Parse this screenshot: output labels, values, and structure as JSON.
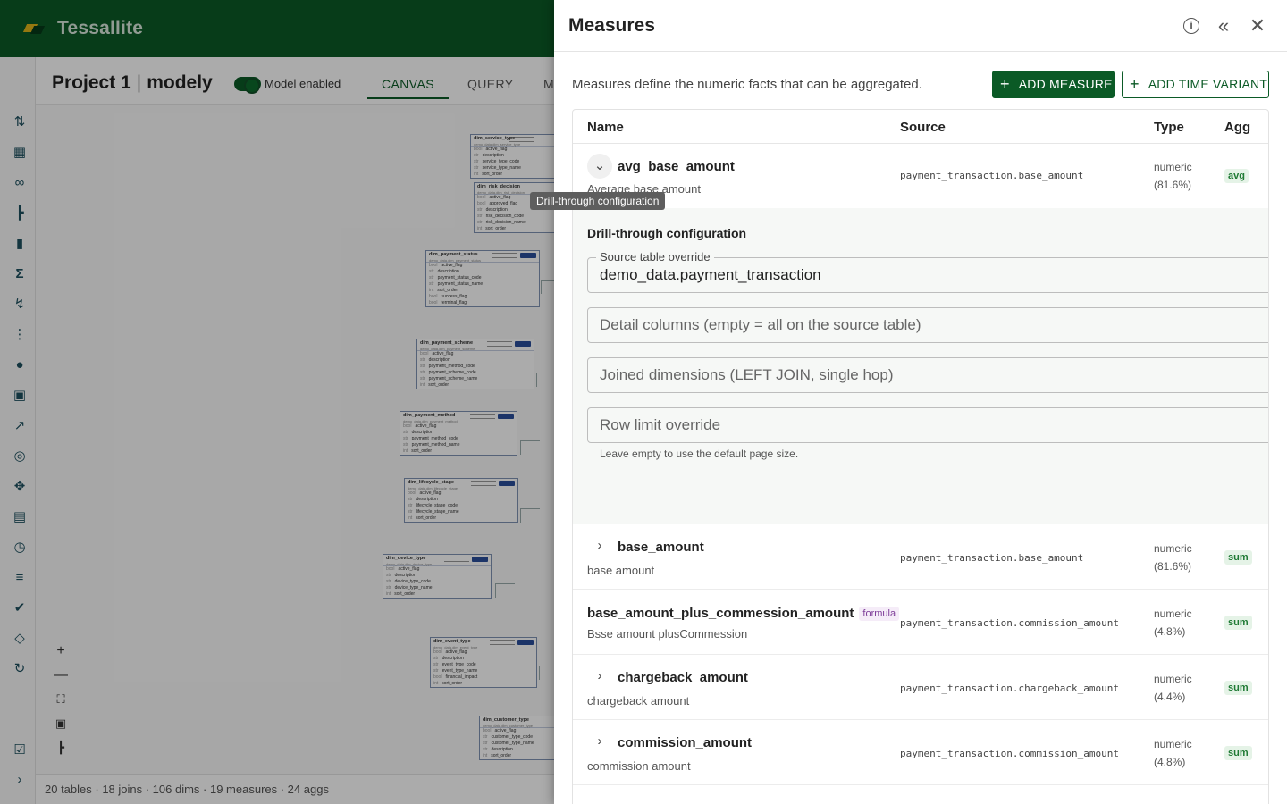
{
  "app": {
    "name": "Tessallite"
  },
  "header": {
    "project": "Project 1",
    "separator": "|",
    "model": "modely",
    "toggle_label": "Model enabled",
    "tabs": [
      {
        "label": "CANVAS",
        "active": true
      },
      {
        "label": "QUERY",
        "active": false
      },
      {
        "label": "M",
        "active": false
      }
    ]
  },
  "rail": {
    "icons": [
      "modeling-icon",
      "table-icon",
      "link-icon",
      "hierarchy-icon",
      "label-icon",
      "sigma-icon",
      "bolt-icon",
      "grid-icon",
      "users-icon",
      "lock-icon",
      "trend-icon",
      "target-icon",
      "move-icon",
      "book-icon",
      "history-icon",
      "tune-icon",
      "verified-icon",
      "layers-icon",
      "sync-icon",
      "checklist-icon",
      "expand-icon"
    ]
  },
  "canvas": {
    "tables": [
      {
        "name": "dim_service_type",
        "sub": "demo_data.dim_service_type",
        "rows": [
          [
            "bool",
            "active_flag"
          ],
          [
            "str",
            "description"
          ],
          [
            "str",
            "service_type_code"
          ],
          [
            "str",
            "service_type_name"
          ],
          [
            "int",
            "sort_order"
          ]
        ]
      },
      {
        "name": "dim_risk_decision",
        "sub": "demo_data.dim_risk_decision",
        "rows": [
          [
            "bool",
            "active_flag"
          ],
          [
            "bool",
            "approved_flag"
          ],
          [
            "str",
            "description"
          ],
          [
            "str",
            "risk_decision_code"
          ],
          [
            "str",
            "risk_decision_name"
          ],
          [
            "int",
            "sort_order"
          ]
        ]
      },
      {
        "name": "dim_payment_status",
        "sub": "demo_data.dim_payment_status",
        "rows": [
          [
            "bool",
            "active_flag"
          ],
          [
            "str",
            "description"
          ],
          [
            "str",
            "payment_status_code"
          ],
          [
            "str",
            "payment_status_name"
          ],
          [
            "int",
            "sort_order"
          ],
          [
            "bool",
            "success_flag"
          ],
          [
            "bool",
            "terminal_flag"
          ]
        ]
      },
      {
        "name": "dim_payment_scheme",
        "sub": "demo_data.dim_payment_scheme",
        "rows": [
          [
            "bool",
            "active_flag"
          ],
          [
            "str",
            "description"
          ],
          [
            "str",
            "payment_method_code"
          ],
          [
            "str",
            "payment_scheme_code"
          ],
          [
            "str",
            "payment_scheme_name"
          ],
          [
            "int",
            "sort_order"
          ]
        ]
      },
      {
        "name": "dim_payment_method",
        "sub": "demo_data.dim_payment_method",
        "rows": [
          [
            "bool",
            "active_flag"
          ],
          [
            "str",
            "description"
          ],
          [
            "str",
            "payment_method_code"
          ],
          [
            "str",
            "payment_method_name"
          ],
          [
            "int",
            "sort_order"
          ]
        ]
      },
      {
        "name": "dim_lifecycle_stage",
        "sub": "demo_data.dim_lifecycle_stage",
        "rows": [
          [
            "bool",
            "active_flag"
          ],
          [
            "str",
            "description"
          ],
          [
            "str",
            "lifecycle_stage_code"
          ],
          [
            "str",
            "lifecycle_stage_name"
          ],
          [
            "int",
            "sort_order"
          ]
        ]
      },
      {
        "name": "dim_device_type",
        "sub": "demo_data.dim_device_type",
        "rows": [
          [
            "bool",
            "active_flag"
          ],
          [
            "str",
            "description"
          ],
          [
            "str",
            "device_type_code"
          ],
          [
            "str",
            "device_type_name"
          ],
          [
            "int",
            "sort_order"
          ]
        ]
      },
      {
        "name": "dim_event_type",
        "sub": "demo_data.dim_event_type",
        "rows": [
          [
            "bool",
            "active_flag"
          ],
          [
            "str",
            "description"
          ],
          [
            "str",
            "event_type_code"
          ],
          [
            "str",
            "event_type_name"
          ],
          [
            "bool",
            "financial_impact"
          ],
          [
            "int",
            "sort_order"
          ]
        ]
      },
      {
        "name": "dim_customer_type",
        "sub": "demo_data.dim_customer_type",
        "rows": [
          [
            "bool",
            "active_flag"
          ],
          [
            "str",
            "customer_type_code"
          ],
          [
            "str",
            "customer_type_name"
          ],
          [
            "str",
            "description"
          ],
          [
            "int",
            "sort_order"
          ]
        ]
      }
    ],
    "zoom": {
      "in": "+",
      "out": "—"
    },
    "status": "20 tables · 18 joins · 106 dims · 19 measures · 24 aggs"
  },
  "tooltip": "Drill-through configuration",
  "drawer": {
    "title": "Measures",
    "description": "Measures define the numeric facts that can be aggregated.",
    "add_measure": "ADD MEASURE",
    "add_time_variant": "ADD TIME VARIANT",
    "columns": {
      "name": "Name",
      "source": "Source",
      "type": "Type",
      "agg": "Agg"
    },
    "drill": {
      "title": "Drill-through configuration",
      "source_override_label": "Source table override",
      "source_override_value": "demo_data.payment_transaction",
      "detail_columns_placeholder": "Detail columns (empty = all on the source table)",
      "joined_dimensions_placeholder": "Joined dimensions (LEFT JOIN, single hop)",
      "row_limit_placeholder": "Row limit override",
      "row_limit_helper": "Leave empty to use the default page size."
    },
    "measures": [
      {
        "name": "avg_base_amount",
        "description": "Average base amount",
        "source": "payment_transaction.base_amount",
        "type": "numeric",
        "coverage": "(81.6%)",
        "agg": "avg",
        "expanded": true
      },
      {
        "name": "base_amount",
        "description": "base amount",
        "source": "payment_transaction.base_amount",
        "type": "numeric",
        "coverage": "(81.6%)",
        "agg": "sum"
      },
      {
        "name": "base_amount_plus_commession_amount",
        "badge": "formula",
        "description": "Bsse amount plusCommession",
        "source": "payment_transaction.commission_amount",
        "type": "numeric",
        "coverage": "(4.8%)",
        "agg": "sum"
      },
      {
        "name": "chargeback_amount",
        "description": "chargeback amount",
        "source": "payment_transaction.chargeback_amount",
        "type": "numeric",
        "coverage": "(4.4%)",
        "agg": "sum"
      },
      {
        "name": "commission_amount",
        "description": "commission amount",
        "source": "payment_transaction.commission_amount",
        "type": "numeric",
        "coverage": "(4.8%)",
        "agg": "sum"
      }
    ]
  }
}
